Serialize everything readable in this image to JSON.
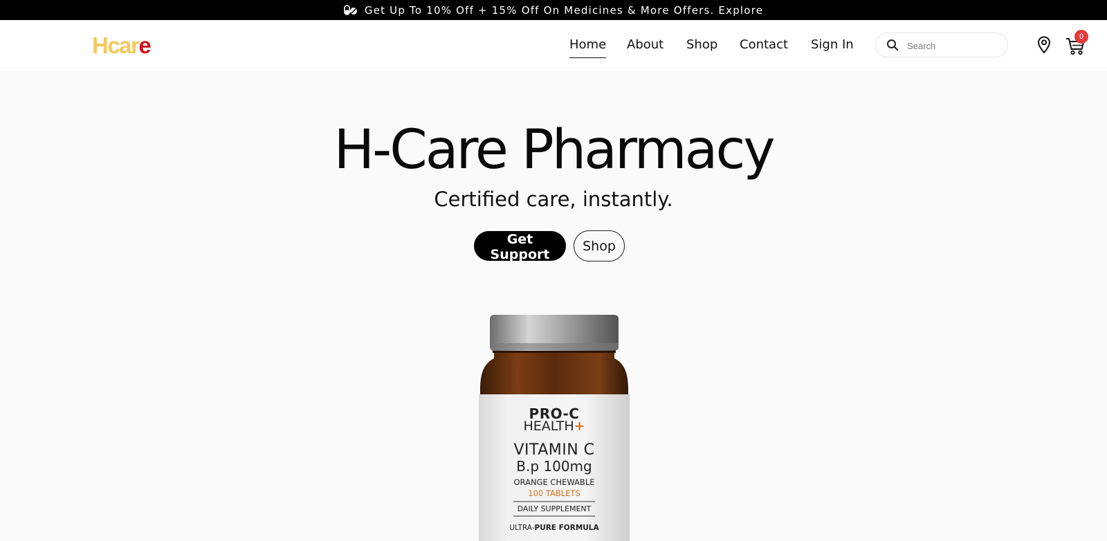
{
  "promo": {
    "text": "Get Up To 10% Off + 15% Off On Medicines & More Offers. Explore",
    "icon": "pills-icon"
  },
  "header": {
    "logo": {
      "part1": "Hcar",
      "part2": "e"
    },
    "nav": [
      {
        "label": "Home",
        "active": true
      },
      {
        "label": "About"
      },
      {
        "label": "Shop"
      },
      {
        "label": "Contact"
      },
      {
        "label": "Sign In"
      }
    ],
    "search": {
      "placeholder": "Search",
      "value": ""
    },
    "cart": {
      "count": "0"
    }
  },
  "hero": {
    "title": "H-Care Pharmacy",
    "subtitle": "Certified care, instantly.",
    "primary_button": "Get Support",
    "secondary_button": "Shop"
  },
  "product": {
    "brand1": "PRO-C",
    "brand2": "HEALTH",
    "brand_plus": "+",
    "name1": "VITAMIN C",
    "name2": "B.p 100mg",
    "flavor": "ORANGE CHEWABLE",
    "count": "100 TABLETS",
    "type": "DAILY SUPPLEMENT",
    "formula_a": "ULTRA-",
    "formula_b": "PURE FORMULA"
  },
  "colors": {
    "logo_yellow": "#f2c860",
    "logo_red": "#d1121b",
    "badge": "#e03b3b",
    "accent_orange": "#d2731c"
  }
}
